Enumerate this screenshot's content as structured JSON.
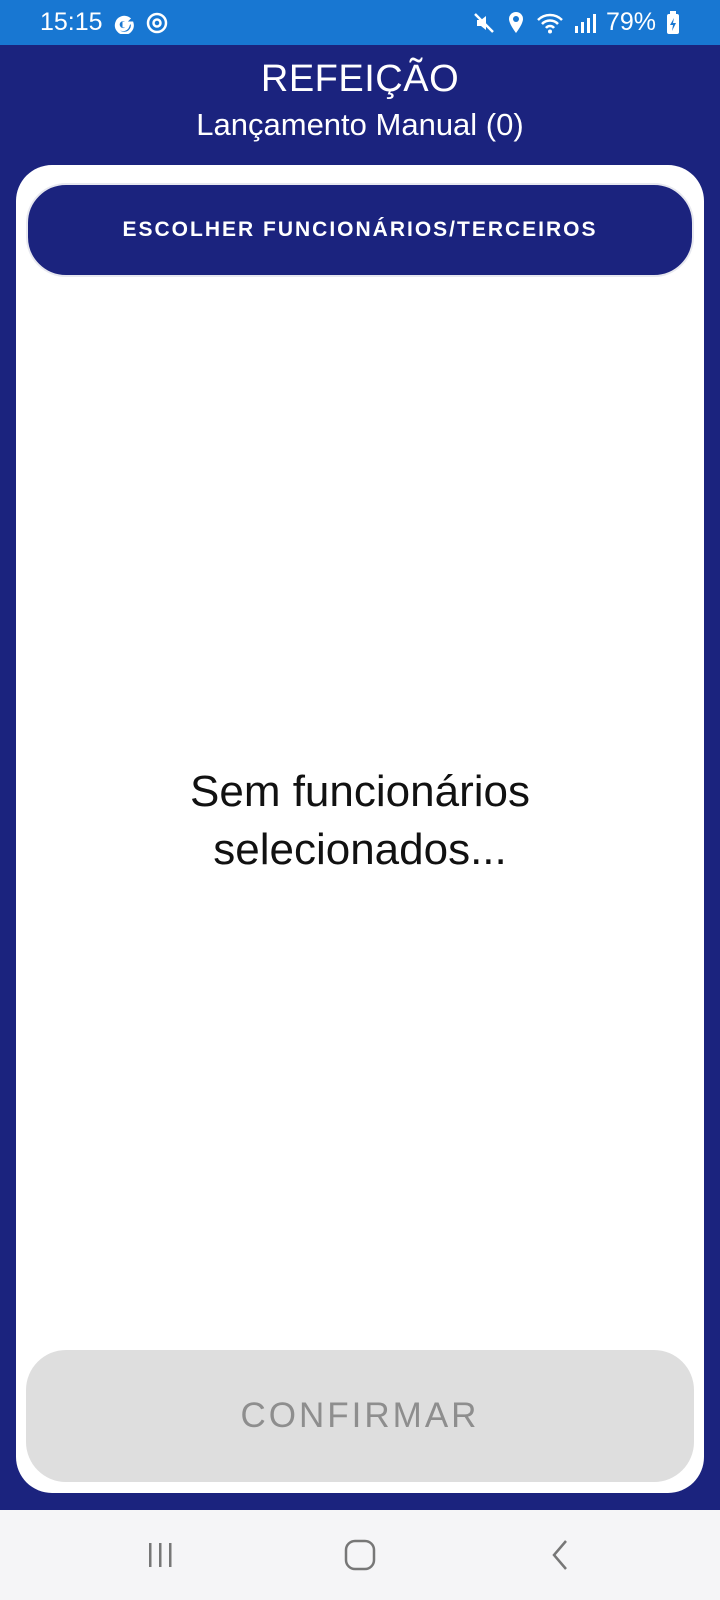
{
  "status_bar": {
    "time": "15:15",
    "battery_percent": "79%",
    "icons": [
      "google-icon",
      "sync-icon",
      "mute-icon",
      "location-icon",
      "wifi-icon",
      "signal-icon",
      "battery-charging-icon"
    ]
  },
  "header": {
    "title": "REFEIÇÃO",
    "subtitle": "Lançamento Manual (0)"
  },
  "main": {
    "choose_button_label": "ESCOLHER FUNCIONÁRIOS/TERCEIROS",
    "empty_message_line1": "Sem funcionários",
    "empty_message_line2": "selecionados...",
    "confirm_button_label": "CONFIRMAR"
  },
  "navigation": {
    "buttons": [
      "recent-apps-icon",
      "home-icon",
      "back-icon"
    ]
  },
  "colors": {
    "primary": "#1b237e",
    "status_bar": "#1877d2",
    "disabled_button": "#dedede",
    "disabled_text": "#8e8e8e"
  }
}
